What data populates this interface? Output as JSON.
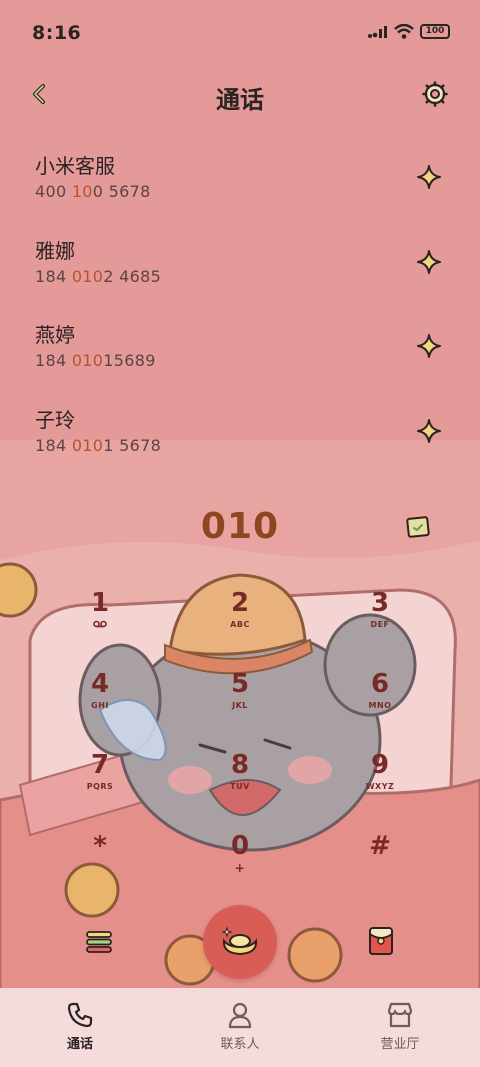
{
  "status_bar": {
    "time": "8:16",
    "battery": "100"
  },
  "header": {
    "title": "通话"
  },
  "contacts": [
    {
      "name": "小米客服",
      "num_pre": "400 ",
      "num_hl": "10",
      "num_post": "0 5678"
    },
    {
      "name": "雅娜",
      "num_pre": "184 ",
      "num_hl": "010",
      "num_post": "2 4685"
    },
    {
      "name": "燕婷",
      "num_pre": "184 ",
      "num_hl": "010",
      "num_post": "15689"
    },
    {
      "name": "子玲",
      "num_pre": "184 ",
      "num_hl": "010",
      "num_post": "1 5678"
    }
  ],
  "dial": {
    "number": "010"
  },
  "keypad": [
    {
      "digit": "1",
      "letters": ""
    },
    {
      "digit": "2",
      "letters": "ABC"
    },
    {
      "digit": "3",
      "letters": "DEF"
    },
    {
      "digit": "4",
      "letters": "GHI"
    },
    {
      "digit": "5",
      "letters": "JKL"
    },
    {
      "digit": "6",
      "letters": "MNO"
    },
    {
      "digit": "7",
      "letters": "PQRS"
    },
    {
      "digit": "8",
      "letters": "TUV"
    },
    {
      "digit": "9",
      "letters": "WXYZ"
    },
    {
      "digit": "*",
      "letters": ""
    },
    {
      "digit": "0",
      "letters": "+"
    },
    {
      "digit": "#",
      "letters": ""
    }
  ],
  "nav": {
    "calls": "通话",
    "contacts": "联系人",
    "hall": "营业厅"
  },
  "icons": {
    "back": "chevron-left-icon",
    "settings": "gear-icon",
    "favorite": "sparkle-star-icon",
    "note": "note-icon",
    "menu": "menu-icon",
    "call": "gold-ingot-icon",
    "card": "red-envelope-icon",
    "voicemail": "voicemail-icon"
  },
  "colors": {
    "accent": "#8e4622",
    "call_button": "#d85d57",
    "background": "#e39a98",
    "nav_background": "#f5dbdc"
  }
}
